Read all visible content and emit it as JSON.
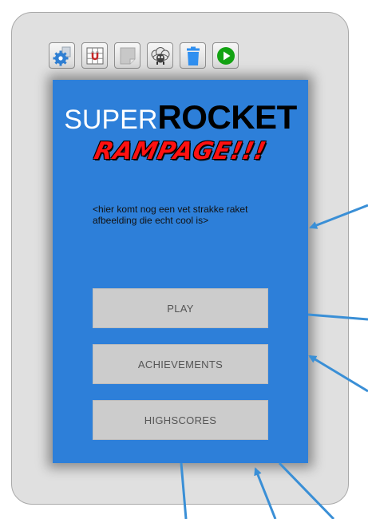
{
  "toolbar": {
    "buttons": [
      {
        "icon": "settings-gear-icon"
      },
      {
        "icon": "grid-magnet-icon"
      },
      {
        "icon": "blank-page-icon"
      },
      {
        "icon": "sheep-icon"
      },
      {
        "icon": "trash-icon"
      },
      {
        "icon": "play-icon"
      }
    ]
  },
  "screen": {
    "title_part1": "SUPER",
    "title_part2": "ROCKET",
    "subtitle": "RAMPAGE!!!",
    "image_placeholder": "<hier komt nog een vet strakke raket afbeelding die echt cool is>",
    "buttons": {
      "play": "PLAY",
      "achievements": "ACHIEVEMENTS",
      "highscores": "HIGHSCORES"
    }
  },
  "colors": {
    "screen_background": "#2d7fd9",
    "subtitle": "#ff1111",
    "arrow": "#3a8fd6",
    "button_background": "#cccccc"
  }
}
